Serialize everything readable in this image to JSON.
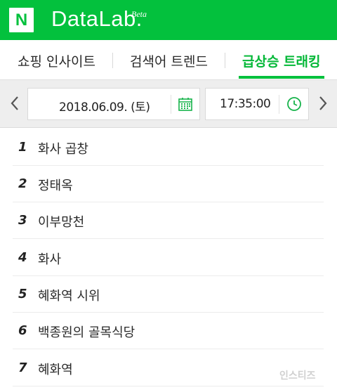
{
  "header": {
    "logo": "N",
    "brand": "DataLab.",
    "beta": "Beta",
    "bg_color": "#03c13d"
  },
  "tabs": [
    {
      "label": "쇼핑 인사이트",
      "active": false
    },
    {
      "label": "검색어 트렌드",
      "active": false
    },
    {
      "label": "급상승 트래킹",
      "active": true
    }
  ],
  "datebar": {
    "prev_icon": "chevron-left-icon",
    "next_icon": "chevron-right-icon",
    "date_value": "2018.06.09. (토)",
    "date_icon": "calendar-icon",
    "time_value": "17:35:00",
    "time_icon": "clock-icon"
  },
  "ranking": [
    {
      "rank": "1",
      "keyword": "화사 곱창"
    },
    {
      "rank": "2",
      "keyword": "정태옥"
    },
    {
      "rank": "3",
      "keyword": "이부망천"
    },
    {
      "rank": "4",
      "keyword": "화사"
    },
    {
      "rank": "5",
      "keyword": "혜화역 시위"
    },
    {
      "rank": "6",
      "keyword": "백종원의 골목식당"
    },
    {
      "rank": "7",
      "keyword": "혜화역"
    }
  ],
  "watermark": "인스티즈",
  "colors": {
    "accent": "#03c13d",
    "active_tab": "#04b838"
  }
}
